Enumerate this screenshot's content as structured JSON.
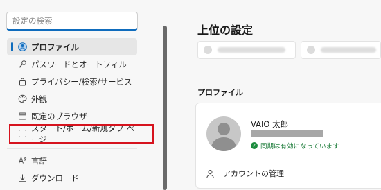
{
  "search": {
    "placeholder": "設定の検索"
  },
  "sidebar": {
    "items": [
      {
        "label": "プロファイル",
        "icon": "profile-icon"
      },
      {
        "label": "パスワードとオートフィル",
        "icon": "key-icon"
      },
      {
        "label": "プライバシー/検索/サービス",
        "icon": "lock-icon"
      },
      {
        "label": "外観",
        "icon": "palette-icon"
      },
      {
        "label": "既定のブラウザー",
        "icon": "browser-icon"
      },
      {
        "label": "スタート/ホーム/新規タブ ページ",
        "icon": "home-page-icon"
      },
      {
        "label": "言語",
        "icon": "language-icon"
      },
      {
        "label": "ダウンロード",
        "icon": "download-icon"
      }
    ]
  },
  "main": {
    "title": "上位の設定",
    "profile_section": {
      "heading": "プロファイル",
      "user_name": "VAIO 太郎",
      "sync_status": "同期は有効になっています",
      "manage_label": "アカウントの管理"
    }
  },
  "colors": {
    "accent": "#0f6cbd",
    "highlight_box": "#d6131e",
    "sync_green": "#1c7c3a"
  }
}
